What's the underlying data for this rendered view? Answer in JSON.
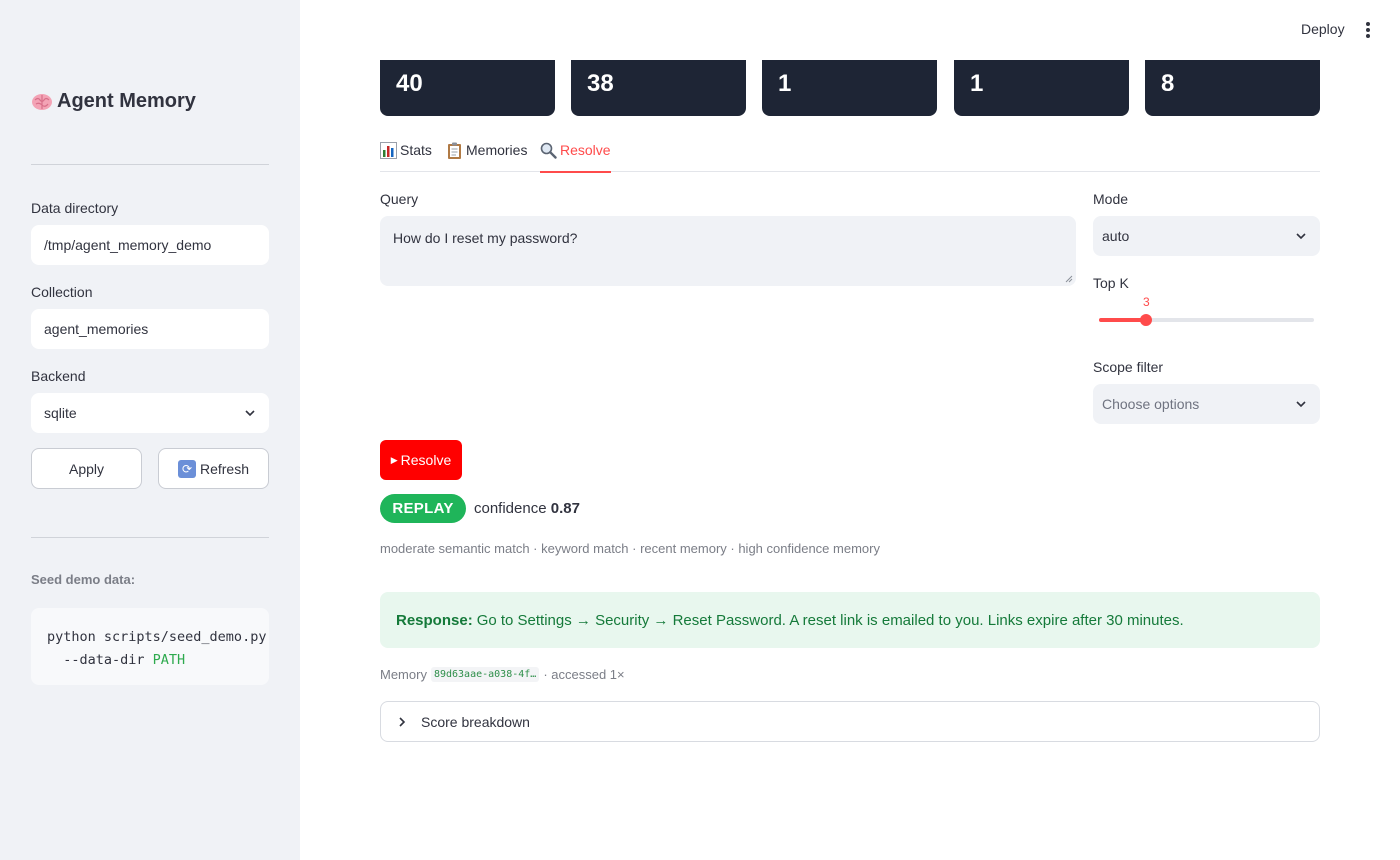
{
  "sidebar": {
    "title": "Agent Memory",
    "title_icon": "brain-icon",
    "data_directory": {
      "label": "Data directory",
      "value": "/tmp/agent_memory_demo"
    },
    "collection": {
      "label": "Collection",
      "value": "agent_memories"
    },
    "backend": {
      "label": "Backend",
      "value": "sqlite"
    },
    "apply_label": "Apply",
    "refresh_label": "Refresh",
    "seed_label": "Seed demo data:",
    "code_line1": "python scripts/seed_demo.py",
    "code_line2_prefix": "  --data-dir ",
    "code_line2_arg": "PATH"
  },
  "header": {
    "deploy_label": "Deploy"
  },
  "metrics": [
    "40",
    "38",
    "1",
    "1",
    "8"
  ],
  "tabs": [
    {
      "label": "Stats",
      "icon": "bar-chart-icon"
    },
    {
      "label": "Memories",
      "icon": "clipboard-icon"
    },
    {
      "label": "Resolve",
      "icon": "magnifier-icon",
      "active": true
    }
  ],
  "query": {
    "label": "Query",
    "value": "How do I reset my password?"
  },
  "mode": {
    "label": "Mode",
    "value": "auto"
  },
  "top_k": {
    "label": "Top K",
    "value": "3",
    "fraction": 0.22
  },
  "scope_filter": {
    "label": "Scope filter",
    "placeholder": "Choose options"
  },
  "resolve_button": "Resolve",
  "result": {
    "badge": "REPLAY",
    "confidence_label": "confidence",
    "confidence_value": "0.87",
    "reasons": "moderate semantic match · keyword match · recent memory · high confidence memory",
    "response_label": "Response:",
    "response_text": "Go to Settings → Security → Reset Password. A reset link is emailed to you. Links expire after 30 minutes.",
    "memory_label": "Memory",
    "memory_id": "89d63aae-a038-4f…",
    "accessed": "· accessed 1×"
  },
  "expander_label": "Score breakdown",
  "colors": {
    "accent": "#ff4b4b",
    "primary_button": "#ff0000",
    "replay_badge": "#1fb55a",
    "metric_card": "#1e2535"
  }
}
